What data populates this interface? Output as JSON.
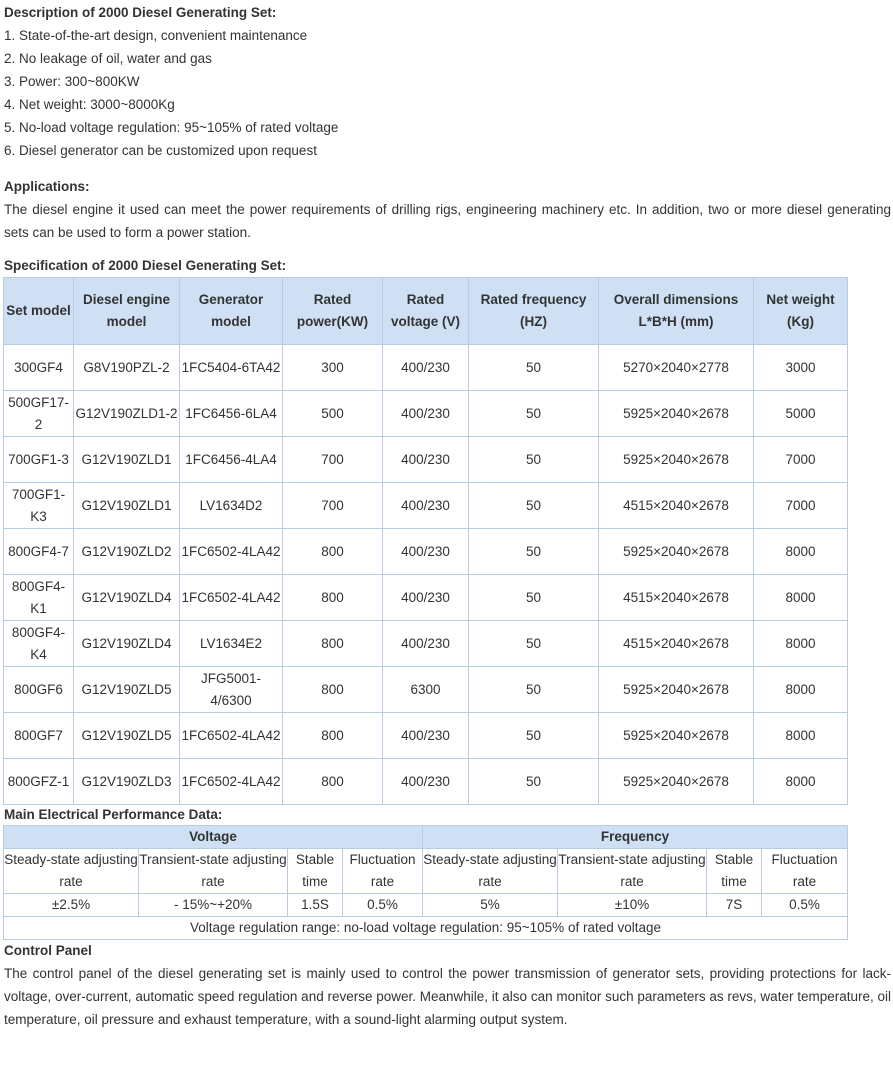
{
  "description": {
    "heading": "Description of 2000 Diesel Generating Set:",
    "items": [
      "1. State-of-the-art design, convenient maintenance",
      "2. No leakage of oil, water and gas",
      "3. Power: 300~800KW",
      "4. Net weight: 3000~8000Kg",
      "5. No-load voltage regulation: 95~105% of rated voltage",
      "6. Diesel generator can be customized upon request"
    ]
  },
  "applications": {
    "heading": "Applications:",
    "text": "The diesel engine it used can meet the power requirements of drilling rigs, engineering machinery etc. In addition, two or more diesel generating sets can be used to form a power station."
  },
  "specification": {
    "heading": "Specification of 2000 Diesel Generating Set:",
    "headers": [
      "Set model",
      "Diesel engine model",
      "Generator model",
      "Rated power(KW)",
      "Rated voltage (V)",
      "Rated frequency (HZ)",
      "Overall dimensions L*B*H (mm)",
      "Net weight (Kg)"
    ],
    "rows": [
      [
        "300GF4",
        "G8V190PZL-2",
        "1FC5404-6TA42",
        "300",
        "400/230",
        "50",
        "5270×2040×2778",
        "3000"
      ],
      [
        "500GF17-2",
        "G12V190ZLD1-2",
        "1FC6456-6LA4",
        "500",
        "400/230",
        "50",
        "5925×2040×2678",
        "5000"
      ],
      [
        "700GF1-3",
        "G12V190ZLD1",
        "1FC6456-4LA4",
        "700",
        "400/230",
        "50",
        "5925×2040×2678",
        "7000"
      ],
      [
        "700GF1-K3",
        "G12V190ZLD1",
        "LV1634D2",
        "700",
        "400/230",
        "50",
        "4515×2040×2678",
        "7000"
      ],
      [
        "800GF4-7",
        "G12V190ZLD2",
        "1FC6502-4LA42",
        "800",
        "400/230",
        "50",
        "5925×2040×2678",
        "8000"
      ],
      [
        "800GF4-K1",
        "G12V190ZLD4",
        "1FC6502-4LA42",
        "800",
        "400/230",
        "50",
        "4515×2040×2678",
        "8000"
      ],
      [
        "800GF4-K4",
        "G12V190ZLD4",
        "LV1634E2",
        "800",
        "400/230",
        "50",
        "4515×2040×2678",
        "8000"
      ],
      [
        "800GF6",
        "G12V190ZLD5",
        "JFG5001-4/6300",
        "800",
        "6300",
        "50",
        "5925×2040×2678",
        "8000"
      ],
      [
        "800GF7",
        "G12V190ZLD5",
        "1FC6502-4LA42",
        "800",
        "400/230",
        "50",
        "5925×2040×2678",
        "8000"
      ],
      [
        "800GFZ-1",
        "G12V190ZLD3",
        "1FC6502-4LA42",
        "800",
        "400/230",
        "50",
        "5925×2040×2678",
        "8000"
      ]
    ]
  },
  "performance": {
    "heading": "Main Electrical Performance Data:",
    "groups": [
      "Voltage",
      "Frequency"
    ],
    "subheaders": [
      "Steady-state adjusting rate",
      "Transient-state adjusting rate",
      "Stable time",
      "Fluctuation rate",
      "Steady-state adjusting rate",
      "Transient-state adjusting rate",
      "Stable time",
      "Fluctuation rate"
    ],
    "values": [
      "±2.5%",
      "- 15%~+20%",
      "1.5S",
      "0.5%",
      "5%",
      "±10%",
      "7S",
      "0.5%"
    ],
    "note": "Voltage regulation range: no-load voltage regulation: 95~105% of rated voltage"
  },
  "control_panel": {
    "heading": "Control Panel",
    "text": "The control panel of the diesel generating set is mainly used to control the power transmission of generator sets, providing protections for lack-voltage, over-current, automatic speed regulation and reverse power. Meanwhile, it also can monitor such parameters as revs, water temperature, oil temperature, oil pressure and exhaust temperature, with a sound-light alarming output system."
  }
}
